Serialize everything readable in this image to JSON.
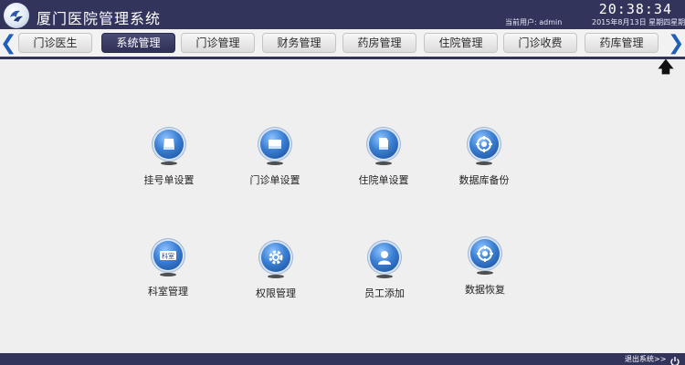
{
  "app": {
    "title": "厦门医院管理系统",
    "clock": "20:38:34",
    "user_line": "当前用户: admin",
    "date_line": "2015年8月13日 星期四星期"
  },
  "tabs": [
    {
      "label": "门诊医生",
      "active": false
    },
    {
      "label": "系统管理",
      "active": true
    },
    {
      "label": "门诊管理",
      "active": false
    },
    {
      "label": "财务管理",
      "active": false
    },
    {
      "label": "药房管理",
      "active": false
    },
    {
      "label": "住院管理",
      "active": false
    },
    {
      "label": "门诊收费",
      "active": false
    },
    {
      "label": "药库管理",
      "active": false
    }
  ],
  "nav": {
    "prev_icon": "chevron-left-icon",
    "next_icon": "chevron-right-icon",
    "back_icon": "arrow-up-icon"
  },
  "functions": [
    {
      "label": "挂号单设置",
      "icon": "registration-form-icon"
    },
    {
      "label": "门诊单设置",
      "icon": "outpatient-form-icon"
    },
    {
      "label": "住院单设置",
      "icon": "inpatient-form-icon"
    },
    {
      "label": "数据库备份",
      "icon": "database-backup-icon"
    },
    {
      "label": "科室管理",
      "icon": "department-icon",
      "icon_text": "科室"
    },
    {
      "label": "权限管理",
      "icon": "permission-gear-icon"
    },
    {
      "label": "员工添加",
      "icon": "add-staff-icon"
    },
    {
      "label": "数据恢复",
      "icon": "data-restore-icon"
    }
  ],
  "footer": {
    "exit_label": "退出系统>>",
    "power_icon": "power-icon"
  },
  "colors": {
    "header_bg": "#33345c",
    "content_bg": "#efefef",
    "active_tab": "#33345c",
    "icon_blue": "#3b7fd3",
    "arrow_blue": "#1f5fb8"
  }
}
